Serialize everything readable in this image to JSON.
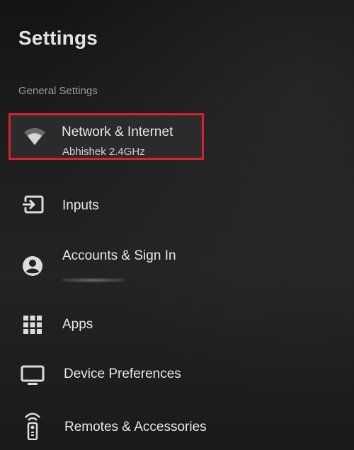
{
  "header": {
    "title": "Settings"
  },
  "section": {
    "label": "General Settings"
  },
  "menu": {
    "items": [
      {
        "label": "Network & Internet",
        "sublabel": "Abhishek 2.4GHz",
        "icon": "wifi-icon",
        "focused": true
      },
      {
        "label": "Inputs",
        "icon": "input-icon"
      },
      {
        "label": "Accounts & Sign In",
        "icon": "account-icon"
      },
      {
        "label": "Apps",
        "icon": "apps-grid-icon"
      },
      {
        "label": "Device Preferences",
        "icon": "tv-icon"
      },
      {
        "label": "Remotes & Accessories",
        "icon": "remote-icon"
      }
    ]
  },
  "colors": {
    "focus_border": "#d7222f",
    "text_primary": "#e8e8e8",
    "text_secondary": "#9c9c9c"
  }
}
